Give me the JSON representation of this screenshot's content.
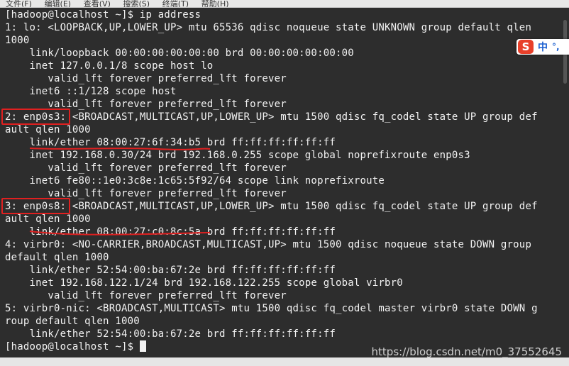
{
  "menubar": {
    "items": [
      "文件(F)",
      "编辑(E)",
      "查看(V)",
      "搜索(S)",
      "终端(T)",
      "帮助(H)"
    ]
  },
  "terminal": {
    "lines": [
      "[hadoop@localhost ~]$ ip address",
      "1: lo: <LOOPBACK,UP,LOWER_UP> mtu 65536 qdisc noqueue state UNKNOWN group default qlen",
      "1000",
      "    link/loopback 00:00:00:00:00:00 brd 00:00:00:00:00:00",
      "    inet 127.0.0.1/8 scope host lo",
      "       valid_lft forever preferred_lft forever",
      "    inet6 ::1/128 scope host",
      "       valid_lft forever preferred_lft forever",
      "2: enp0s3: <BROADCAST,MULTICAST,UP,LOWER_UP> mtu 1500 qdisc fq_codel state UP group def",
      "ault qlen 1000",
      "    link/ether 08:00:27:6f:34:b5 brd ff:ff:ff:ff:ff:ff",
      "    inet 192.168.0.30/24 brd 192.168.0.255 scope global noprefixroute enp0s3",
      "       valid_lft forever preferred_lft forever",
      "    inet6 fe80::1e0:3c8e:1c65:5f92/64 scope link noprefixroute",
      "       valid_lft forever preferred_lft forever",
      "3: enp0s8: <BROADCAST,MULTICAST,UP,LOWER_UP> mtu 1500 qdisc fq_codel state UP group def",
      "ault qlen 1000",
      "    link/ether 08:00:27:c0:8c:5a brd ff:ff:ff:ff:ff:ff",
      "4: virbr0: <NO-CARRIER,BROADCAST,MULTICAST,UP> mtu 1500 qdisc noqueue state DOWN group",
      "default qlen 1000",
      "    link/ether 52:54:00:ba:67:2e brd ff:ff:ff:ff:ff:ff",
      "    inet 192.168.122.1/24 brd 192.168.122.255 scope global virbr0",
      "       valid_lft forever preferred_lft forever",
      "5: virbr0-nic: <BROADCAST,MULTICAST> mtu 1500 qdisc fq_codel master virbr0 state DOWN g",
      "roup default qlen 1000",
      "    link/ether 52:54:00:ba:67:2e brd ff:ff:ff:ff:ff:ff"
    ],
    "prompt": "[hadoop@localhost ~]$ ",
    "highlighted_interfaces": [
      "2: enp0s3:",
      "3: enp0s8:"
    ]
  },
  "ime": {
    "logo": "S",
    "mode": "中",
    "punct": "°,"
  },
  "watermark": "https://blog.csdn.net/m0_37552645",
  "colors": {
    "terminal_bg": "#2d2d2d",
    "terminal_fg": "#f2f2f2",
    "annotation": "#e02020"
  }
}
